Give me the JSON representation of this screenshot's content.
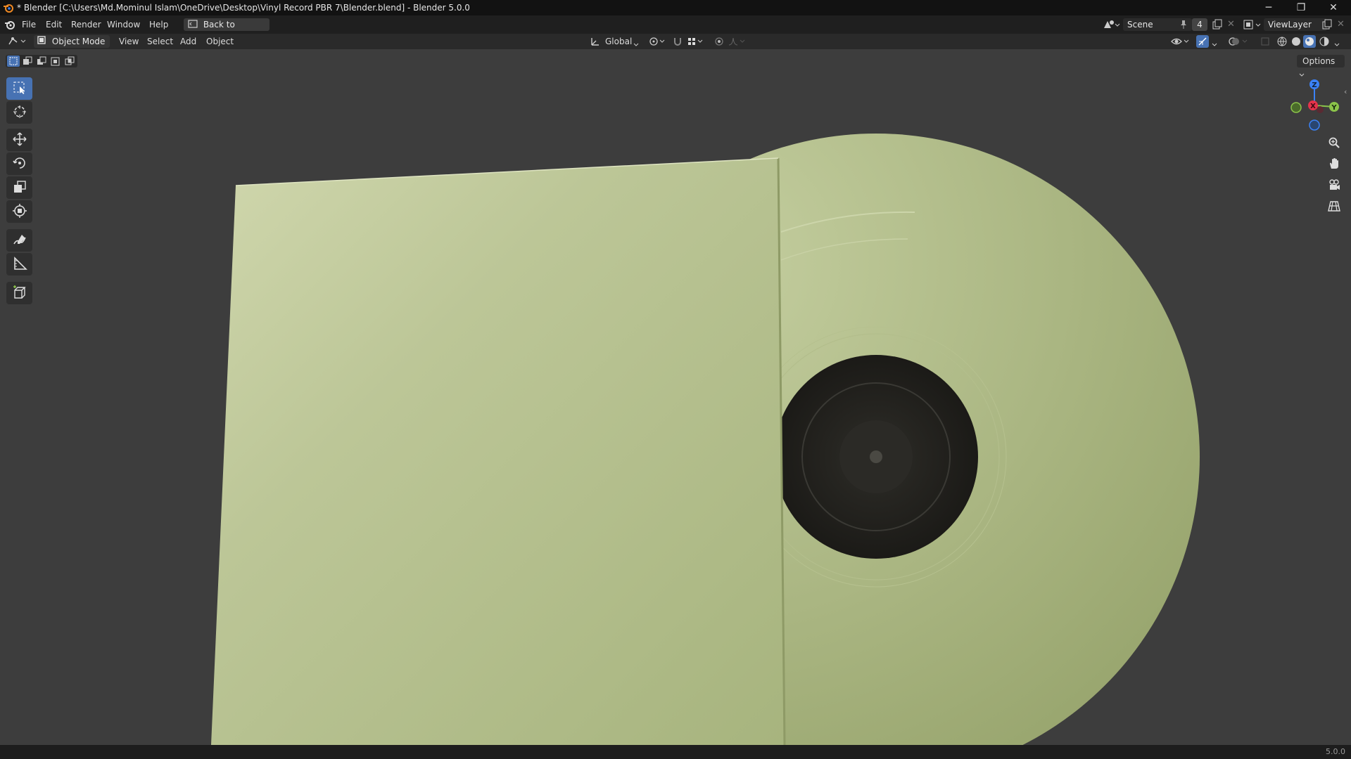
{
  "window": {
    "title": "* Blender [C:\\Users\\Md.Mominul Islam\\OneDrive\\Desktop\\Vinyl Record PBR 7\\Blender.blend] - Blender 5.0.0",
    "minimize": "─",
    "maximize": "❐",
    "close": "✕"
  },
  "menu": {
    "items": [
      "File",
      "Edit",
      "Render",
      "Window",
      "Help"
    ],
    "back_button": "Back to Previous",
    "scene_name": "Scene",
    "scene_count": "4",
    "view_layer": "ViewLayer"
  },
  "header": {
    "mode": "Object Mode",
    "menus": [
      "View",
      "Select",
      "Add",
      "Object"
    ],
    "transform_orientation": "Global",
    "options": "Options"
  },
  "gizmo": {
    "x_label": "X",
    "y_label": "Y",
    "z_label": "Z",
    "x_color": "#e5334b",
    "y_color": "#8bc34a",
    "z_color": "#3b82f6"
  },
  "status": {
    "version": "5.0.0"
  },
  "colors": {
    "accent": "#4772b3",
    "sleeve": "#b9c495",
    "vinyl": "#a9b583"
  }
}
